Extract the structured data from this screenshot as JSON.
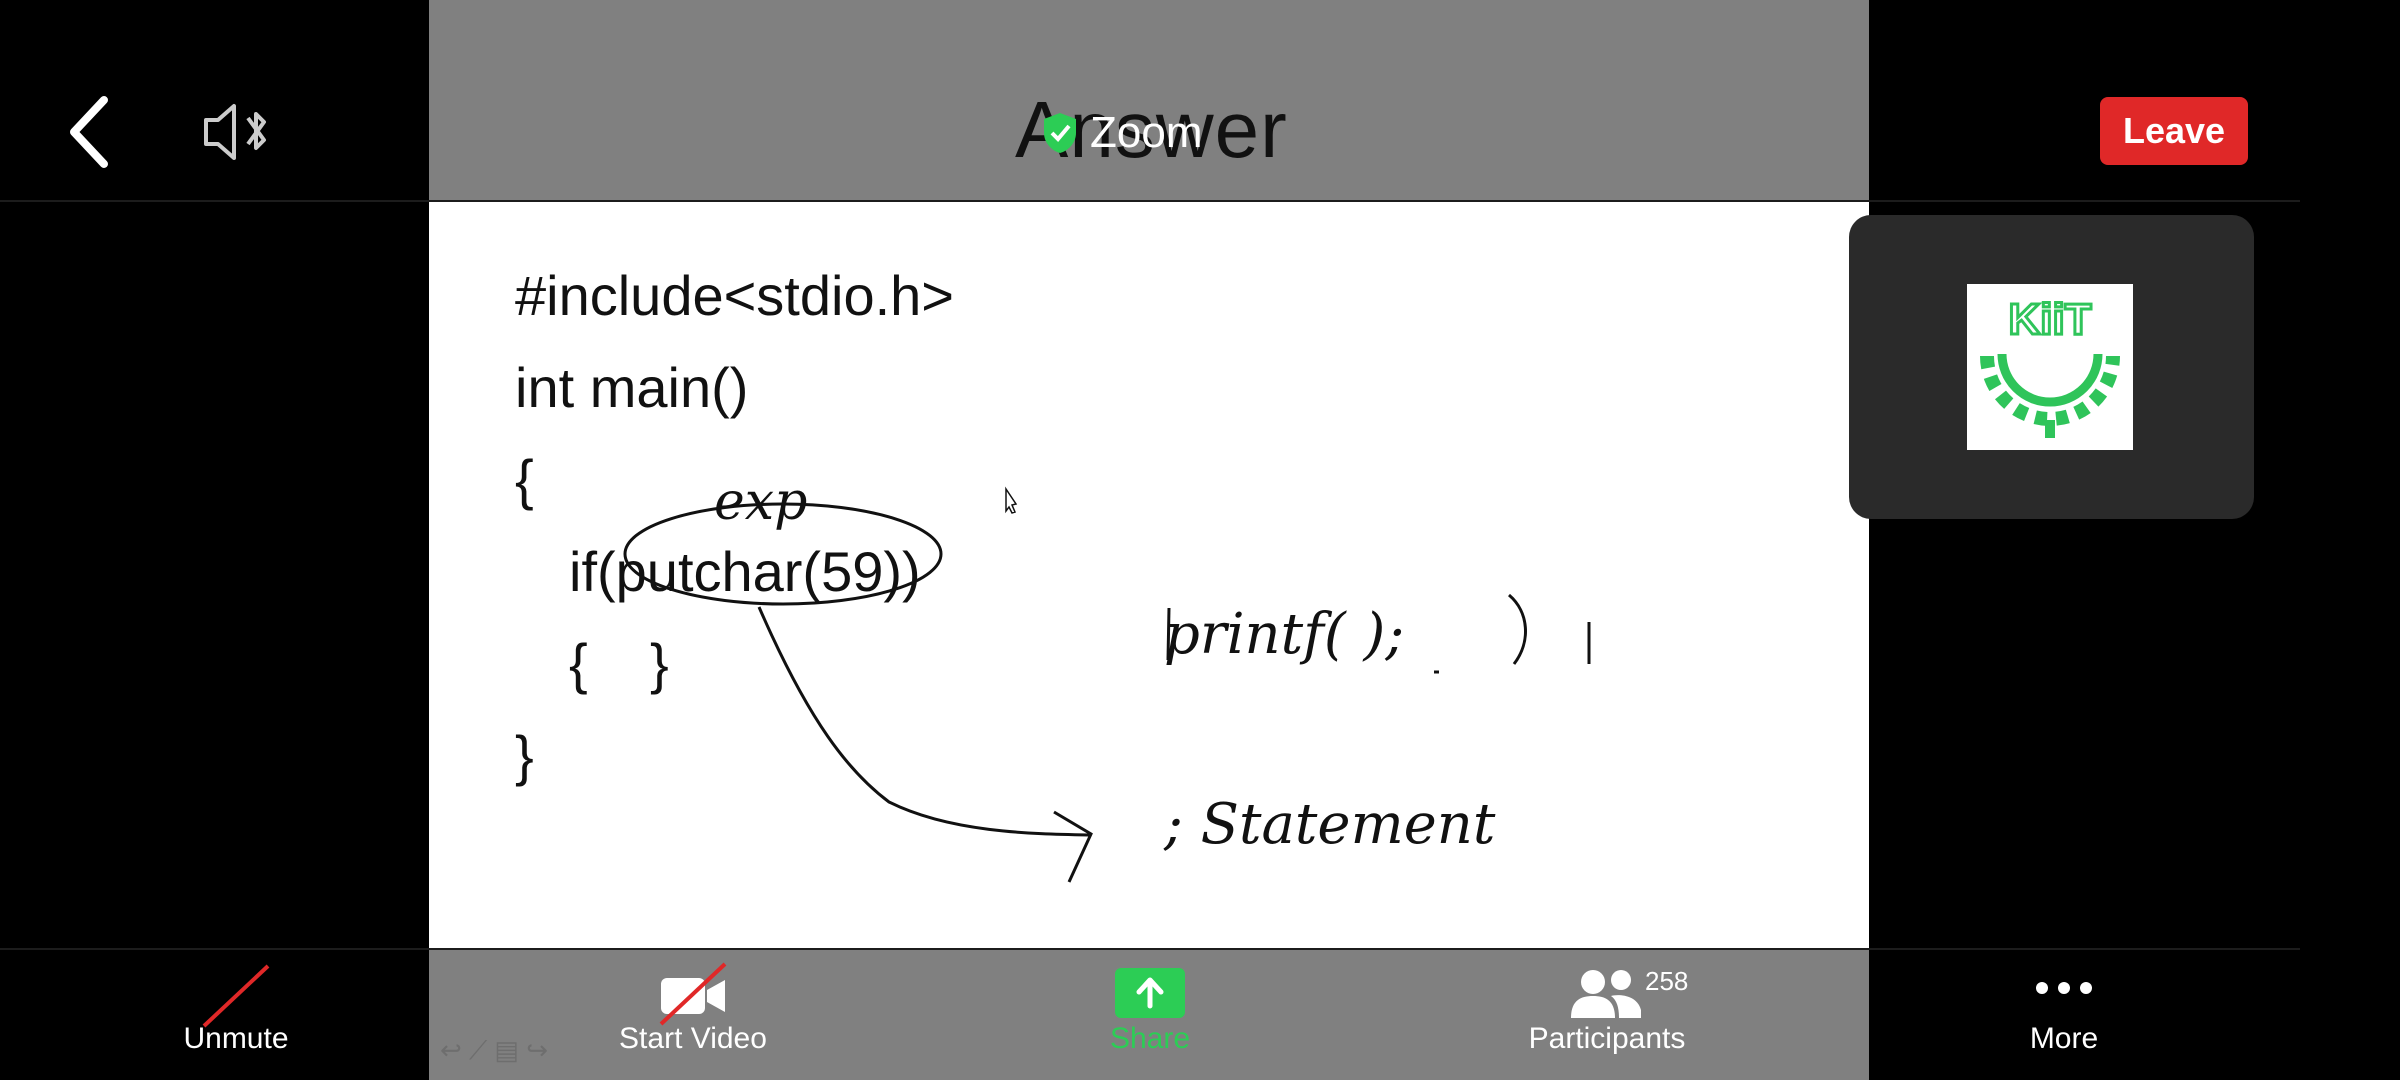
{
  "top_bar": {
    "meeting_title": "Zoom",
    "leave_label": "Leave"
  },
  "slide": {
    "title": "Answer",
    "code_lines": [
      "#include<stdio.h>",
      "int main()",
      "{",
      "if(putchar(59))",
      "{    }",
      "}"
    ],
    "annotations": {
      "over_putchar": "exp",
      "printf_note": "printf(    );",
      "statement_note": "; Statement"
    }
  },
  "toolbar": {
    "unmute_label": "Unmute",
    "start_video_label": "Start Video",
    "share_label": "Share",
    "participants_label": "Participants",
    "participants_count": "258",
    "more_label": "More"
  },
  "colors": {
    "leave": "#e02828",
    "share_green": "#2ccd55",
    "mute_slash": "#e02828",
    "kiit_green": "#2fc45a"
  },
  "icons": {
    "back": "chevron-left-icon",
    "audio": "speaker-bluetooth-icon",
    "shield": "shield-check-icon",
    "mic": "mic-muted-icon",
    "video": "video-off-icon",
    "share": "share-arrow-icon",
    "participants": "people-icon",
    "more": "ellipsis-icon"
  }
}
